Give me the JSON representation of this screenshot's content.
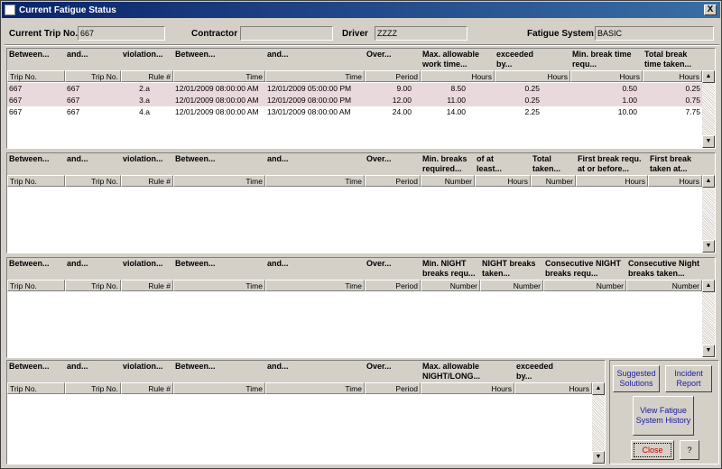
{
  "window": {
    "title": "Current Fatigue Status",
    "close_glyph": "X"
  },
  "header": {
    "trip_label": "Current Trip No.",
    "trip_value": "667",
    "contractor_label": "Contractor",
    "contractor_value": "",
    "driver_label": "Driver",
    "driver_value": "ZZZZ",
    "fatigue_label": "Fatigue System",
    "fatigue_value": "BASIC"
  },
  "panel1": {
    "groups": [
      "Between...",
      "and...",
      "violation...",
      "Between...",
      "and...",
      "Over...",
      "Max. allowable\nwork time...",
      "exceeded\nby...",
      "Min. break time\nrequ...",
      "Total break\ntime taken..."
    ],
    "columns": [
      "Trip No.",
      "Trip No.",
      "Rule #",
      "Time",
      "Time",
      "Period",
      "Hours",
      "Hours",
      "Hours",
      "Hours"
    ],
    "rows": [
      [
        "667",
        "667",
        "2.a",
        "12/01/2009 08:00:00 AM",
        "12/01/2009 05:00:00 PM",
        "9.00",
        "8.50",
        "0.25",
        "0.50",
        "0.25"
      ],
      [
        "667",
        "667",
        "3.a",
        "12/01/2009 08:00:00 AM",
        "12/01/2009 08:00:00 PM",
        "12.00",
        "11.00",
        "0.25",
        "1.00",
        "0.75"
      ],
      [
        "667",
        "667",
        "4.a",
        "12/01/2009 08:00:00 AM",
        "13/01/2009 08:00:00 AM",
        "24.00",
        "14.00",
        "2.25",
        "10.00",
        "7.75"
      ]
    ]
  },
  "panel2": {
    "groups": [
      "Between...",
      "and...",
      "violation...",
      "Between...",
      "and...",
      "Over...",
      "Min. breaks\nrequired...",
      "of at\nleast...",
      "Total\ntaken...",
      "First break requ.\nat or before...",
      "First break\ntaken at..."
    ],
    "columns": [
      "Trip No.",
      "Trip No.",
      "Rule #",
      "Time",
      "Time",
      "Period",
      "Number",
      "Hours",
      "Number",
      "Hours",
      "Hours"
    ]
  },
  "panel3": {
    "groups": [
      "Between...",
      "and...",
      "violation...",
      "Between...",
      "and...",
      "Over...",
      "Min. NIGHT\nbreaks requ...",
      "NIGHT breaks\ntaken...",
      "Consecutive NIGHT\nbreaks requ...",
      "Consecutive Night\nbreaks taken..."
    ],
    "columns": [
      "Trip No.",
      "Trip No.",
      "Rule #",
      "Time",
      "Time",
      "Period",
      "Number",
      "Number",
      "Number",
      "Number"
    ]
  },
  "panel4": {
    "groups": [
      "Between...",
      "and...",
      "violation...",
      "Between...",
      "and...",
      "Over...",
      "Max. allowable\nNIGHT/LONG...",
      "exceeded\nby..."
    ],
    "columns": [
      "Trip No.",
      "Trip No.",
      "Rule #",
      "Time",
      "Time",
      "Period",
      "Hours",
      "Hours"
    ]
  },
  "buttons": {
    "suggested": "Suggested Solutions",
    "incident": "Incident Report",
    "history": "View Fatigue System History",
    "close": "Close",
    "help": "?"
  },
  "colors": {
    "row_highlight": "#ead9dc",
    "title_start": "#0a246a",
    "title_end": "#3a6ea5",
    "link_text": "#1a1aa0",
    "close_text": "#cc0000"
  }
}
